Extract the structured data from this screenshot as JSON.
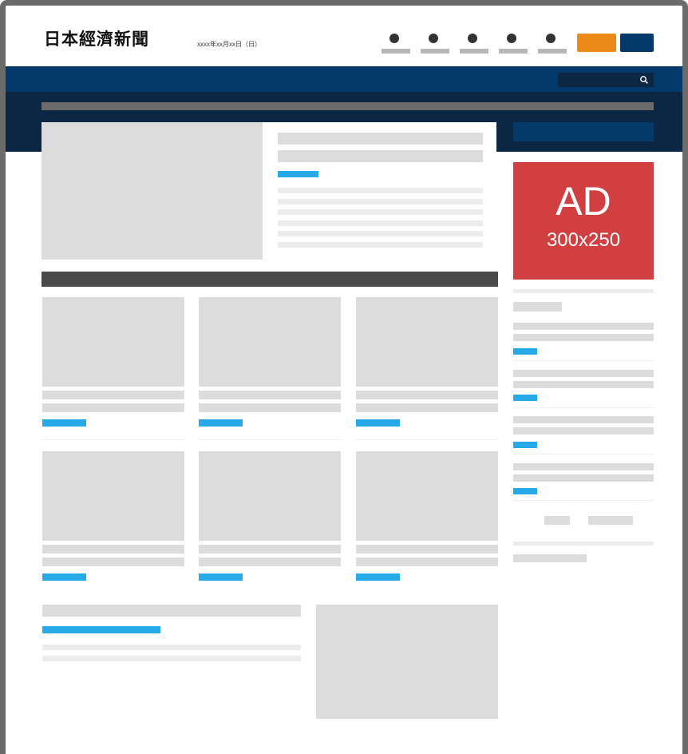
{
  "header": {
    "logo_text": "日本經濟新聞",
    "date_text": "xxxx年xx月xx日（日）",
    "nav_item_count": 5,
    "colors": {
      "nav_band": "#043a6b",
      "dark_band": "#0c2743",
      "orange_button": "#ec8a17",
      "blue_button": "#043a6b",
      "accent_link": "#26aae7",
      "ad": "#d23f41"
    }
  },
  "search": {
    "icon": "search-icon"
  },
  "ad": {
    "label": "AD",
    "size_label": "300x250"
  }
}
